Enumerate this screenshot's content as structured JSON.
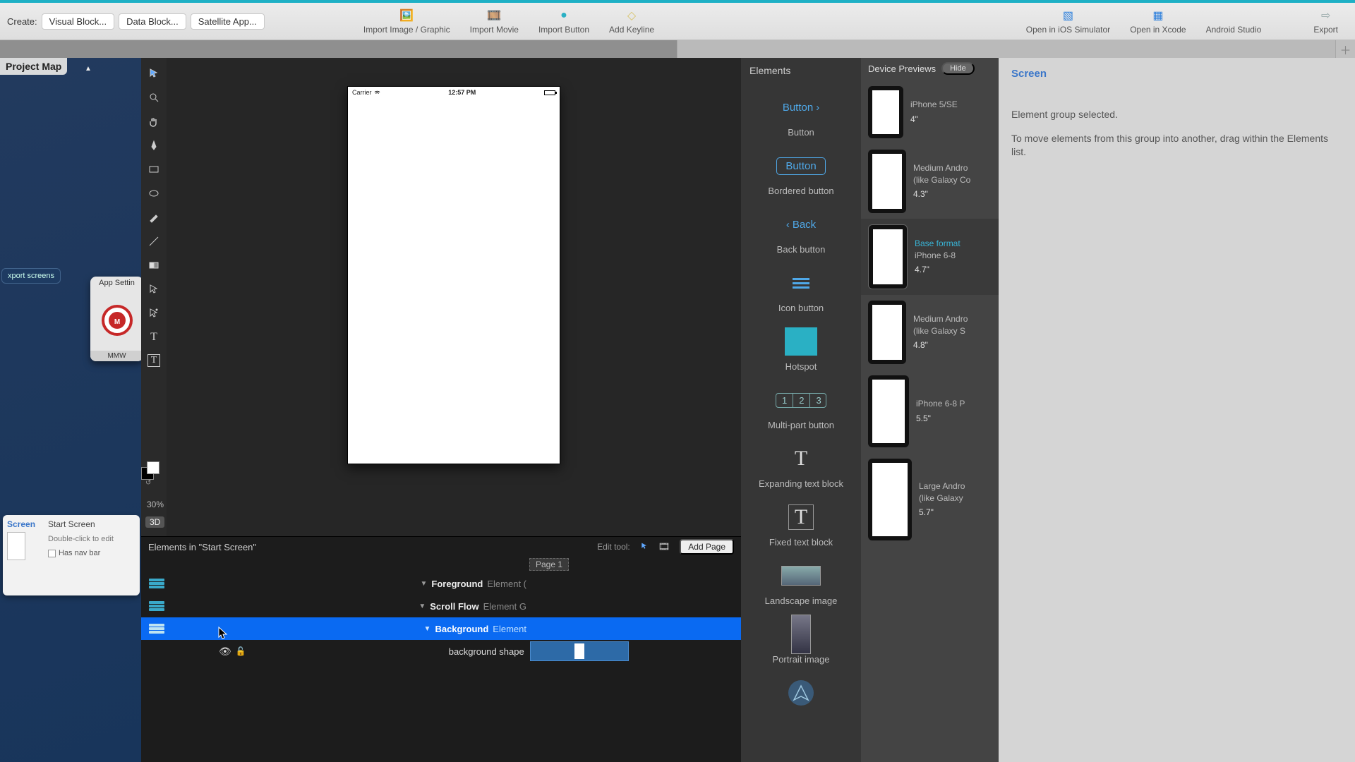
{
  "toolbar": {
    "create_label": "Create:",
    "visual_block": "Visual Block...",
    "data_block": "Data Block...",
    "satellite_app": "Satellite App...",
    "import_image": "Import Image / Graphic",
    "import_movie": "Import Movie",
    "import_button": "Import Button",
    "add_keyline": "Add Keyline",
    "open_sim": "Open in iOS Simulator",
    "open_xcode": "Open in Xcode",
    "android_studio": "Android Studio",
    "export": "Export"
  },
  "projmap": {
    "title": "Project Map",
    "export_screens": "xport screens",
    "app_settings": "App Settin",
    "app_caption": "MMW",
    "screen_tag": "Screen",
    "start_screen": "Start Screen",
    "dbl_click": "Double-click to edit",
    "has_nav": "Has nav bar"
  },
  "canvas": {
    "carrier": "Carrier",
    "time": "12:57 PM",
    "zoom": "30%",
    "btn3d": "3D"
  },
  "layers": {
    "title": "Elements in \"Start Screen\"",
    "edit_tool": "Edit tool:",
    "add_page": "Add Page",
    "page1": "Page 1",
    "rows": [
      {
        "name": "Foreground",
        "type": "Element ("
      },
      {
        "name": "Scroll Flow",
        "type": "Element G"
      },
      {
        "name": "Background",
        "type": "Element"
      },
      {
        "name": "background shape",
        "type": ""
      }
    ]
  },
  "lib": {
    "title": "Elements",
    "items": {
      "button": "Button",
      "bordered": "Bordered button",
      "back": "Back button",
      "back_label": "Back",
      "icon": "Icon button",
      "hotspot": "Hotspot",
      "multi": "Multi-part button",
      "expanding": "Expanding text block",
      "fixed": "Fixed text block",
      "landscape": "Landscape image",
      "portrait": "Portrait image"
    },
    "button_label": "Button",
    "bordered_label": "Button"
  },
  "previews": {
    "title": "Device Previews",
    "hide": "Hide",
    "devices": [
      {
        "name": "iPhone 5/SE",
        "size": "4\""
      },
      {
        "name": "Medium Andro",
        "sub": "(like Galaxy Co",
        "size": "4.3\""
      },
      {
        "base": "Base format",
        "name": "iPhone 6-8",
        "size": "4.7\""
      },
      {
        "name": "Medium Andro",
        "sub": "(like Galaxy S",
        "size": "4.8\""
      },
      {
        "name": "iPhone 6-8 P",
        "size": "5.5\""
      },
      {
        "name": "Large Andro",
        "sub": "(like Galaxy",
        "size": "5.7\""
      }
    ]
  },
  "inspector": {
    "title": "Screen",
    "line1": "Element group selected.",
    "line2": "To move elements from this group into another, drag within the Elements list."
  }
}
